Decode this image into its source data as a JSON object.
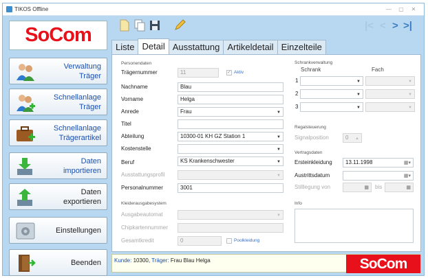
{
  "window": {
    "title": "TIKOS Offline",
    "controls": [
      "—",
      "▢",
      "✕"
    ]
  },
  "brand": {
    "logo": "SoCom"
  },
  "sidebar": {
    "buttons": [
      {
        "line1": "Verwaltung",
        "line2": "Träger",
        "icon": "people-icon"
      },
      {
        "line1": "Schnellanlage",
        "line2": "Träger",
        "icon": "add-people-icon"
      },
      {
        "line1": "Schnellanlage",
        "line2": "Trägerartikel",
        "icon": "suitcase-add-icon"
      },
      {
        "line1": "Daten",
        "line2": "importieren",
        "icon": "import-icon"
      },
      {
        "line1": "Daten",
        "line2": "exportieren",
        "icon": "export-icon"
      },
      {
        "line1": "Einstellungen",
        "line2": "",
        "icon": "settings-icon"
      },
      {
        "line1": "Beenden",
        "line2": "",
        "icon": "exit-door-icon"
      }
    ]
  },
  "toolbar": {
    "icons": [
      "new-document-icon",
      "copy-icon",
      "save-icon",
      "edit-pencil-icon"
    ],
    "nav": [
      "|<",
      "<",
      ">",
      ">|"
    ]
  },
  "tabs": [
    "Liste",
    "Detail",
    "Ausstattung",
    "Artikeldetail",
    "Einzelteile"
  ],
  "active_tab": "Detail",
  "personendaten": {
    "title": "Personendaten",
    "traegernummer": {
      "label": "Trägernummer",
      "value": "11"
    },
    "aktiv": {
      "label": "Aktiv",
      "checked": true
    },
    "nachname": {
      "label": "Nachname",
      "value": "Blau"
    },
    "vorname": {
      "label": "Vorname",
      "value": "Helga"
    },
    "anrede": {
      "label": "Anrede",
      "value": "Frau"
    },
    "titel": {
      "label": "Titel",
      "value": ""
    },
    "abteilung": {
      "label": "Abteilung",
      "value": "10300-01  KH GZ Station 1"
    },
    "kostenstelle": {
      "label": "Kostenstelle",
      "value": ""
    },
    "beruf": {
      "label": "Beruf",
      "value": "KS  Krankenschwester"
    },
    "ausstattungsprofil": {
      "label": "Ausstattungsprofil",
      "value": ""
    },
    "personalnummer": {
      "label": "Personalnummer",
      "value": "3001"
    }
  },
  "kleiderausgabe": {
    "title": "Kleiderausgabesystem",
    "ausgabeautomat": {
      "label": "Ausgabeautomat",
      "value": ""
    },
    "chipkartennummer": {
      "label": "Chipkartennummer",
      "value": ""
    },
    "gesamtkredit": {
      "label": "Gesamtkredit",
      "value": "0"
    },
    "poolkleidung": {
      "label": "Poolkleidung",
      "checked": false
    }
  },
  "schrankverwaltung": {
    "title": "Schrankverwaltung",
    "col_schrank": "Schrank",
    "col_fach": "Fach",
    "rows": [
      "1",
      "2",
      "3"
    ]
  },
  "regalsteuerung": {
    "title": "Regalsteuerung",
    "signalposition": {
      "label": "Signalposition",
      "value": "0"
    }
  },
  "vertragsdaten": {
    "title": "Vertragsdaten",
    "ersteinkleidung": {
      "label": "Ersteinkleidung",
      "value": "13.11.1998"
    },
    "austrittsdatum": {
      "label": "Austrittsdatum",
      "value": ""
    },
    "stilllegung": {
      "label": "Stilllegung von",
      "bis": "bis"
    }
  },
  "info": {
    "title": "Info"
  },
  "status": {
    "kunde_label": "Kunde:",
    "kunde_value": "10300,",
    "traeger_label": "Träger:",
    "traeger_value": "Frau Blau Helga",
    "logo": "SoCom"
  },
  "colors": {
    "brand_red": "#e8101a",
    "window_bg": "#b7d8f0",
    "label_blue": "#1a4fb0"
  }
}
